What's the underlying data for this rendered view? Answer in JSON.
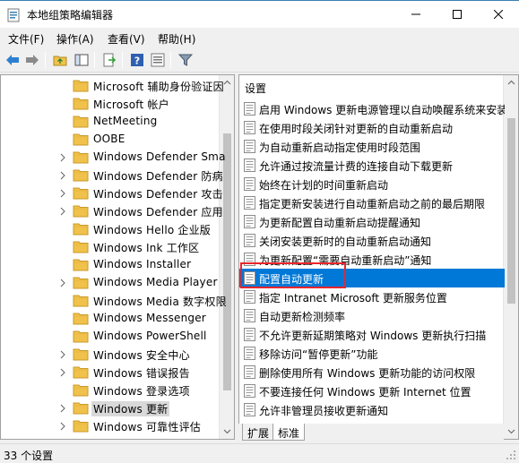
{
  "window": {
    "title": "本地组策略编辑器"
  },
  "menu": {
    "items": [
      "文件(F)",
      "操作(A)",
      "查看(V)",
      "帮助(H)"
    ]
  },
  "tree": {
    "items": [
      {
        "label": "Microsoft 辅助身份验证因",
        "expandable": false
      },
      {
        "label": "Microsoft 帐户",
        "expandable": false
      },
      {
        "label": "NetMeeting",
        "expandable": false
      },
      {
        "label": "OOBE",
        "expandable": false
      },
      {
        "label": "Windows Defender Sma",
        "expandable": true
      },
      {
        "label": "Windows Defender 防病",
        "expandable": true
      },
      {
        "label": "Windows Defender 攻击",
        "expandable": true
      },
      {
        "label": "Windows Defender 应用",
        "expandable": true
      },
      {
        "label": "Windows Hello 企业版",
        "expandable": false
      },
      {
        "label": "Windows Ink 工作区",
        "expandable": false
      },
      {
        "label": "Windows Installer",
        "expandable": false
      },
      {
        "label": "Windows Media Player",
        "expandable": true
      },
      {
        "label": "Windows Media 数字权限",
        "expandable": false
      },
      {
        "label": "Windows Messenger",
        "expandable": false
      },
      {
        "label": "Windows PowerShell",
        "expandable": false
      },
      {
        "label": "Windows 安全中心",
        "expandable": true
      },
      {
        "label": "Windows 错误报告",
        "expandable": true
      },
      {
        "label": "Windows 登录选项",
        "expandable": false
      },
      {
        "label": "Windows 更新",
        "expandable": true,
        "selected": true
      },
      {
        "label": "Windows 可靠性评估",
        "expandable": true
      }
    ]
  },
  "list": {
    "header": "设置",
    "items": [
      {
        "label": "启用 Windows 更新电源管理以自动唤醒系统来安装"
      },
      {
        "label": "在使用时段关闭针对更新的自动重新启动"
      },
      {
        "label": "为自动重新启动指定使用时段范围"
      },
      {
        "label": "允许通过按流量计费的连接自动下载更新"
      },
      {
        "label": "始终在计划的时间重新启动"
      },
      {
        "label": "指定更新安装进行自动重新启动之前的最后期限"
      },
      {
        "label": "为更新配置自动重新启动提醒通知"
      },
      {
        "label": "关闭安装更新时的自动重新启动通知"
      },
      {
        "label": "为更新配置“需要自动重新启动”通知"
      },
      {
        "label": "配置自动更新",
        "selected": true
      },
      {
        "label": "指定 Intranet Microsoft 更新服务位置"
      },
      {
        "label": "自动更新检测频率"
      },
      {
        "label": "不允许更新延期策略对 Windows 更新执行扫描"
      },
      {
        "label": "移除访问“暂停更新”功能"
      },
      {
        "label": "删除使用所有 Windows 更新功能的访问权限"
      },
      {
        "label": "不要连接任何 Windows 更新 Internet 位置"
      },
      {
        "label": "允许非管理员接收更新通知"
      }
    ]
  },
  "tabs": {
    "items": [
      "扩展",
      "标准"
    ],
    "active": 1
  },
  "status": {
    "text": "33 个设置"
  },
  "colors": {
    "selection": "#0078d7",
    "highlight_box": "#e8262b",
    "folder": "#f0c24b"
  }
}
